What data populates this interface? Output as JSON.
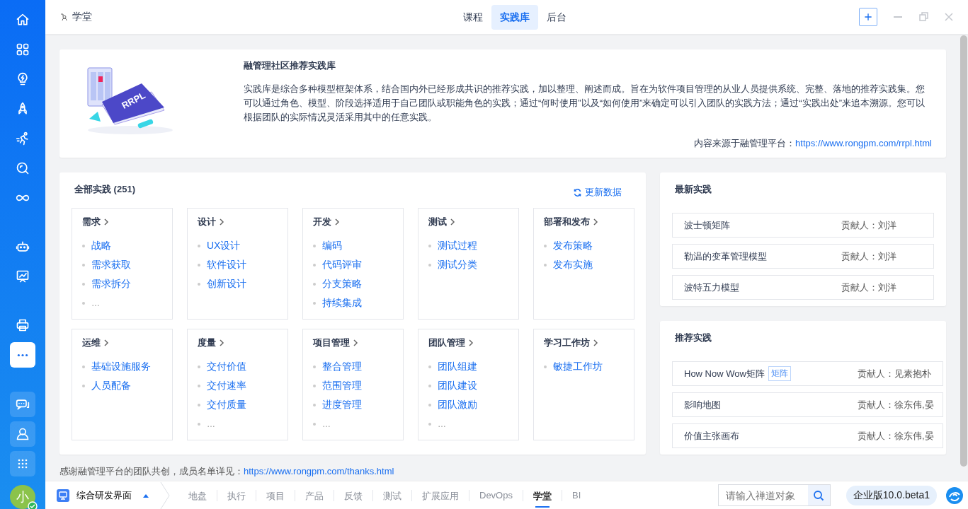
{
  "sidebar": {
    "items": [
      {
        "selected": false
      },
      {
        "selected": false
      },
      {
        "selected": false
      },
      {
        "selected": false
      },
      {
        "selected": false
      },
      {
        "selected": false
      },
      {
        "selected": false
      },
      {
        "selected": false
      },
      {
        "selected": false
      },
      {
        "selected": false
      },
      {
        "selected": true
      }
    ],
    "bottom_items": [
      {
        "selected": false
      },
      {
        "selected": false
      },
      {
        "selected": false
      }
    ],
    "avatar": {
      "text": "小",
      "online": true
    }
  },
  "header": {
    "app_title": "学堂",
    "tabs": [
      {
        "label": "课程",
        "selected": false
      },
      {
        "label": "实践库",
        "selected": true
      },
      {
        "label": "后台",
        "selected": false
      }
    ]
  },
  "intro": {
    "illustration_label": "RRPL",
    "title": "融管理社区推荐实践库",
    "text": "实践库是综合多种模型框架体系，结合国内外已经形成共识的推荐实践，加以整理、阐述而成。旨在为软件项目管理的从业人员提供系统、完整、落地的推荐实践集。您可以通过角色、模型、阶段选择适用于自己团队或职能角色的实践；通过“何时使用”以及“如何使用”来确定可以引入团队的实践方法；通过“实践出处”来追本溯源。您可以根据团队的实际情况灵活采用其中的任意实践。",
    "source_label": "内容来源于融管理平台：",
    "source_link": "https://www.rongpm.com/rrpl.html"
  },
  "all_practices": {
    "title": "全部实践 (251)",
    "refresh": "更新数据",
    "categories": [
      {
        "name": "需求",
        "items": [
          {
            "text": "战略",
            "kind": "link"
          },
          {
            "text": "需求获取",
            "kind": "link"
          },
          {
            "text": "需求拆分",
            "kind": "link"
          },
          {
            "text": "…",
            "kind": "more"
          }
        ]
      },
      {
        "name": "设计",
        "items": [
          {
            "text": "UX设计",
            "kind": "link"
          },
          {
            "text": "软件设计",
            "kind": "link"
          },
          {
            "text": "创新设计",
            "kind": "link"
          }
        ]
      },
      {
        "name": "开发",
        "items": [
          {
            "text": "编码",
            "kind": "link"
          },
          {
            "text": "代码评审",
            "kind": "link"
          },
          {
            "text": "分支策略",
            "kind": "link"
          },
          {
            "text": "持续集成",
            "kind": "link"
          }
        ]
      },
      {
        "name": "测试",
        "items": [
          {
            "text": "测试过程",
            "kind": "link"
          },
          {
            "text": "测试分类",
            "kind": "link"
          }
        ]
      },
      {
        "name": "部署和发布",
        "items": [
          {
            "text": "发布策略",
            "kind": "link"
          },
          {
            "text": "发布实施",
            "kind": "link"
          }
        ]
      },
      {
        "name": "运维",
        "items": [
          {
            "text": "基础设施服务",
            "kind": "link"
          },
          {
            "text": "人员配备",
            "kind": "link"
          }
        ]
      },
      {
        "name": "度量",
        "items": [
          {
            "text": "交付价值",
            "kind": "link"
          },
          {
            "text": "交付速率",
            "kind": "link"
          },
          {
            "text": "交付质量",
            "kind": "link"
          },
          {
            "text": "…",
            "kind": "more"
          }
        ]
      },
      {
        "name": "项目管理",
        "items": [
          {
            "text": "整合管理",
            "kind": "link"
          },
          {
            "text": "范围管理",
            "kind": "link"
          },
          {
            "text": "进度管理",
            "kind": "link"
          },
          {
            "text": "…",
            "kind": "more"
          }
        ]
      },
      {
        "name": "团队管理",
        "items": [
          {
            "text": "团队组建",
            "kind": "link"
          },
          {
            "text": "团队建设",
            "kind": "link"
          },
          {
            "text": "团队激励",
            "kind": "link"
          },
          {
            "text": "…",
            "kind": "more"
          }
        ]
      },
      {
        "name": "学习工作坊",
        "items": [
          {
            "text": "敏捷工作坊",
            "kind": "link"
          }
        ]
      }
    ]
  },
  "latest": {
    "title": "最新实践",
    "rows": [
      {
        "name": "波士顿矩阵",
        "contributor": "贡献人：刘洋"
      },
      {
        "name": "勒温的变革管理模型",
        "contributor": "贡献人：刘洋"
      },
      {
        "name": "波特五力模型",
        "contributor": "贡献人：刘洋"
      }
    ]
  },
  "recommended": {
    "title": "推荐实践",
    "rows": [
      {
        "name": "How Now Wow矩阵",
        "tag": "矩阵",
        "contributor": "贡献人：见素抱朴"
      },
      {
        "name": "影响地图",
        "contributor": "贡献人：徐东伟,晏"
      },
      {
        "name": "价值主张画布",
        "contributor": "贡献人：徐东伟,晏"
      }
    ]
  },
  "thanks": {
    "label": "感谢融管理平台的团队共创，成员名单详见：",
    "link": "https://www.rongpm.com/thanks.html"
  },
  "bottom_bar": {
    "workspace": "综合研发界面",
    "nav": [
      {
        "label": "地盘",
        "selected": false
      },
      {
        "label": "执行",
        "selected": false
      },
      {
        "label": "项目",
        "selected": false
      },
      {
        "label": "产品",
        "selected": false
      },
      {
        "label": "反馈",
        "selected": false
      },
      {
        "label": "测试",
        "selected": false
      },
      {
        "label": "扩展应用",
        "selected": false
      },
      {
        "label": "DevOps",
        "selected": false
      },
      {
        "label": "学堂",
        "selected": true
      },
      {
        "label": "BI",
        "selected": false
      }
    ],
    "search_placeholder": "请输入禅道对象",
    "version": "企业版10.0.beta1"
  }
}
